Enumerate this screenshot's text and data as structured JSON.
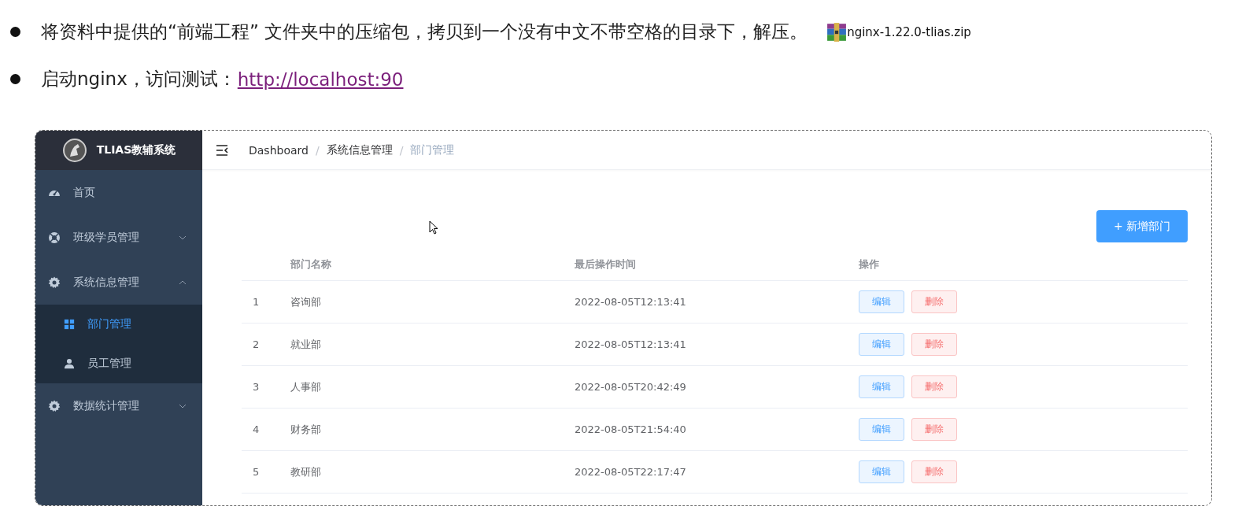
{
  "bullets": [
    {
      "text": "将资料中提供的“前端工程” 文件夹中的压缩包，拷贝到一个没有中文不带空格的目录下，解压。",
      "attachment": {
        "filename": "nginx-1.22.0-tlias.zip"
      }
    },
    {
      "text": "启动nginx，访问测试：",
      "link": "http://localhost:90"
    }
  ],
  "app": {
    "brand": "TLIAS教辅系统",
    "sidebar": {
      "items": [
        {
          "kind": "link",
          "label": "首页"
        },
        {
          "kind": "submenu",
          "label": "班级学员管理",
          "expanded": false
        },
        {
          "kind": "submenu",
          "label": "系统信息管理",
          "expanded": true,
          "children": [
            {
              "label": "部门管理",
              "selected": true
            },
            {
              "label": "员工管理",
              "selected": false
            }
          ]
        },
        {
          "kind": "submenu",
          "label": "数据统计管理",
          "expanded": false
        }
      ]
    },
    "breadcrumb": {
      "separator": "/",
      "items": [
        "Dashboard",
        "系统信息管理",
        "部门管理"
      ]
    },
    "add_button": "+ 新增部门",
    "table": {
      "columns": [
        "部门名称",
        "最后操作时间",
        "操作"
      ],
      "rows": [
        {
          "index": "1",
          "name": "咨询部",
          "time": "2022-08-05T12:13:41",
          "actions": [
            "编辑",
            "删除"
          ]
        },
        {
          "index": "2",
          "name": "就业部",
          "time": "2022-08-05T12:13:41",
          "actions": [
            "编辑",
            "删除"
          ]
        },
        {
          "index": "3",
          "name": "人事部",
          "time": "2022-08-05T20:42:49",
          "actions": [
            "编辑",
            "删除"
          ]
        },
        {
          "index": "4",
          "name": "财务部",
          "time": "2022-08-05T21:54:40",
          "actions": [
            "编辑",
            "删除"
          ]
        },
        {
          "index": "5",
          "name": "教研部",
          "time": "2022-08-05T22:17:47",
          "actions": [
            "编辑",
            "删除"
          ]
        }
      ]
    }
  }
}
